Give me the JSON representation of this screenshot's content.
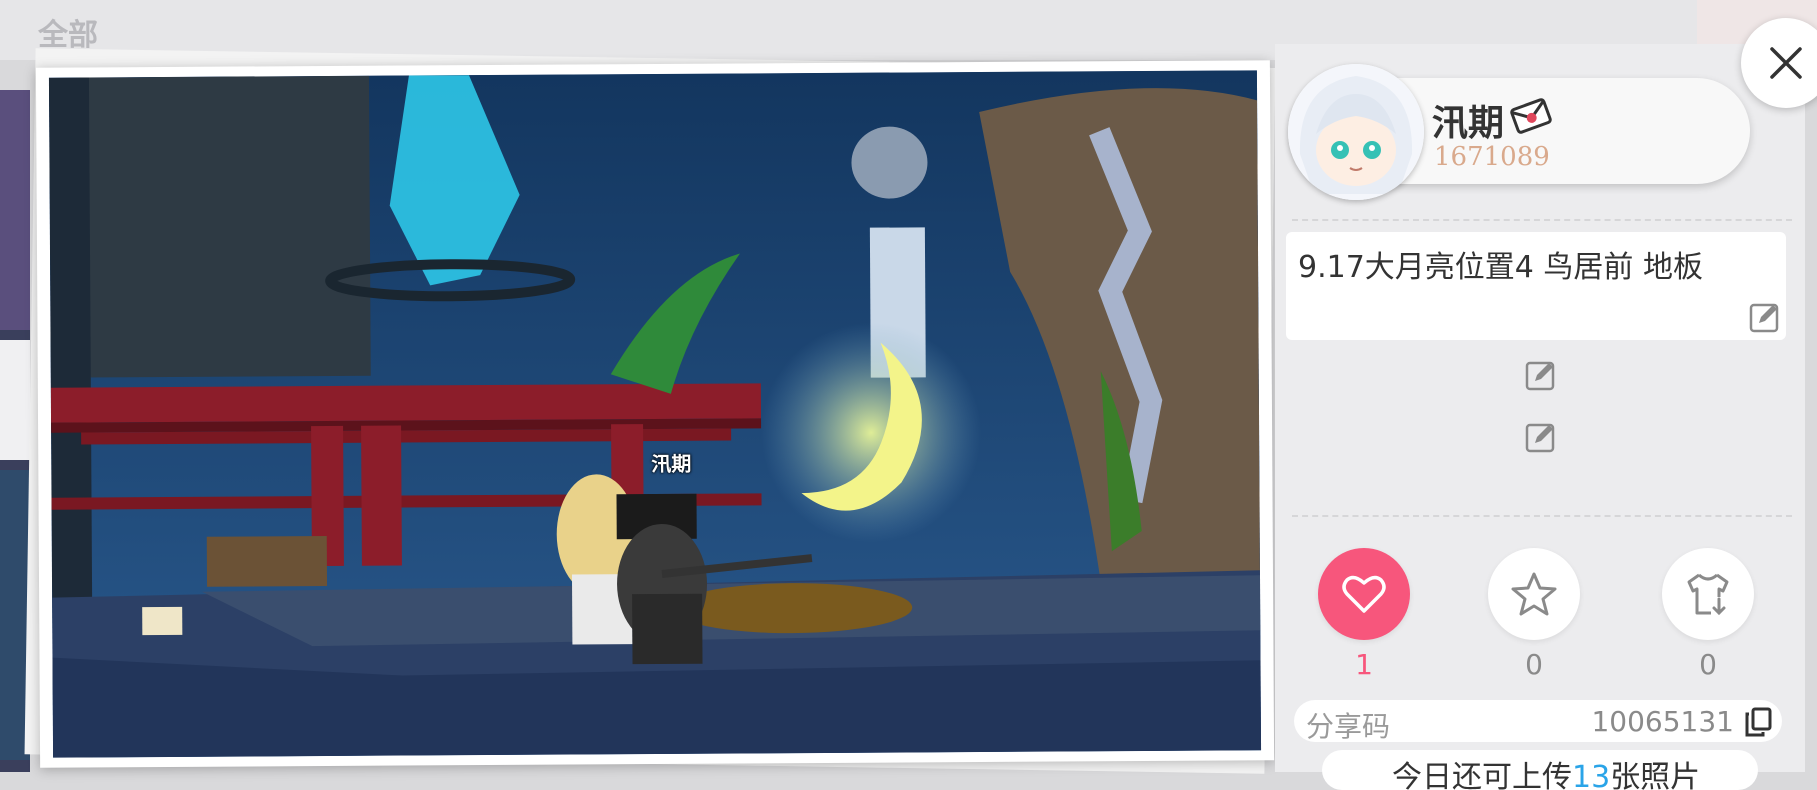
{
  "background": {
    "tab_label": "全部"
  },
  "photo": {
    "player_name": "汛期"
  },
  "user": {
    "name": "汛期",
    "id": "1671089"
  },
  "caption": {
    "text": "9.17大月亮位置4 鸟居前 地板"
  },
  "actions": {
    "like": {
      "icon": "heart-icon",
      "count": "1",
      "color": "#f7567c"
    },
    "favorite": {
      "icon": "star-icon",
      "count": "0"
    },
    "try_on": {
      "icon": "shirt-download-icon",
      "count": "0"
    }
  },
  "share": {
    "label": "分享码",
    "code": "10065131"
  },
  "upload": {
    "prefix": "今日还可上传",
    "count": "13",
    "suffix": "张照片"
  }
}
